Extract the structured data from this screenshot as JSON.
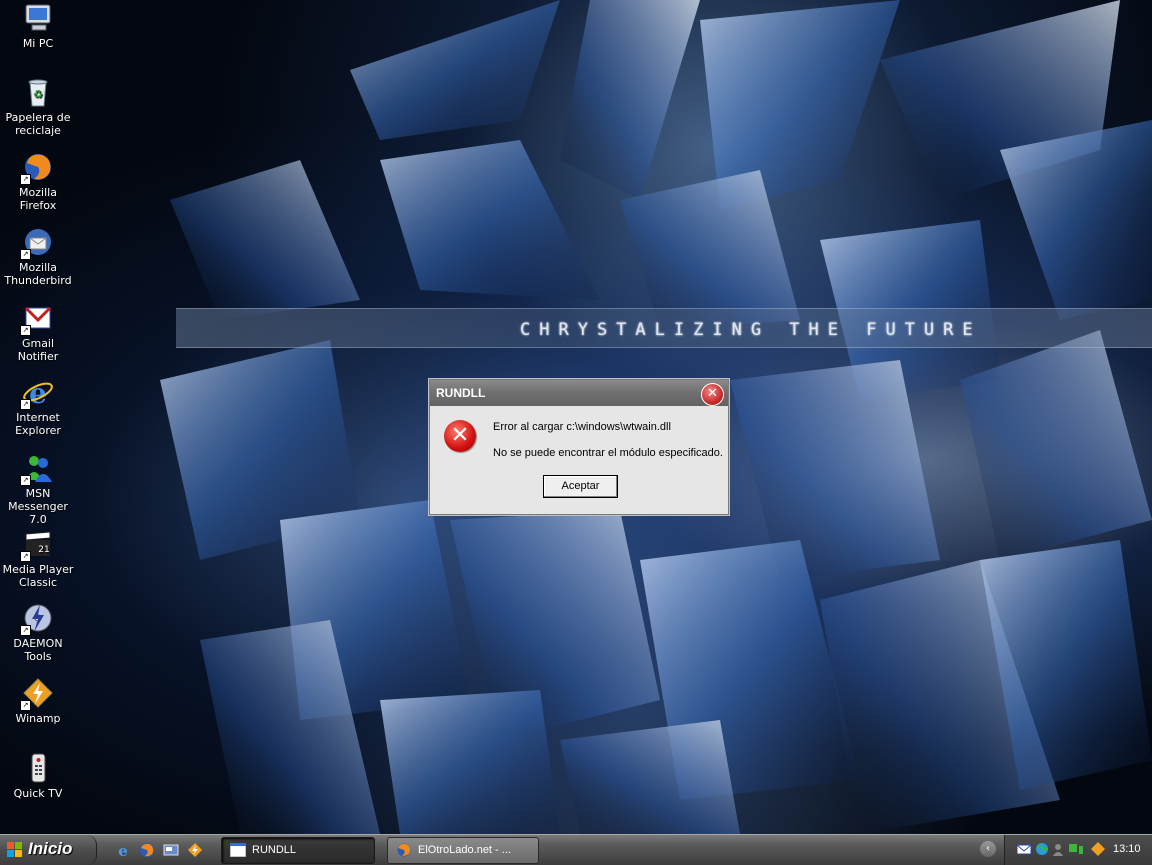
{
  "wallpaper": {
    "banner_text": "CHRYSTALIZING THE FUTURE"
  },
  "desktop_icons": [
    {
      "label": "Mi PC",
      "icon": "my-computer-icon"
    },
    {
      "label": "Papelera de reciclaje",
      "icon": "recycle-bin-icon"
    },
    {
      "label": "Mozilla Firefox",
      "icon": "firefox-icon"
    },
    {
      "label": "Mozilla Thunderbird",
      "icon": "thunderbird-icon"
    },
    {
      "label": "Gmail Notifier",
      "icon": "gmail-icon"
    },
    {
      "label": "Internet Explorer",
      "icon": "internet-explorer-icon"
    },
    {
      "label": "MSN Messenger 7.0",
      "icon": "msn-messenger-icon"
    },
    {
      "label": "Media Player Classic",
      "icon": "media-player-classic-icon"
    },
    {
      "label": "DAEMON Tools",
      "icon": "daemon-tools-icon"
    },
    {
      "label": "Winamp",
      "icon": "winamp-icon"
    },
    {
      "label": "Quick TV",
      "icon": "quick-tv-icon"
    }
  ],
  "dialog": {
    "title": "RUNDLL",
    "close_glyph": "✕",
    "message_line1": "Error al cargar c:\\windows\\wtwain.dll",
    "message_line2": "No se puede encontrar el módulo especificado.",
    "ok_label": "Aceptar"
  },
  "taskbar": {
    "start_label": "Inicio",
    "tasks": [
      {
        "label": "RUNDLL"
      },
      {
        "label": "ElOtroLado.net - ..."
      }
    ],
    "clock": "13:10"
  }
}
